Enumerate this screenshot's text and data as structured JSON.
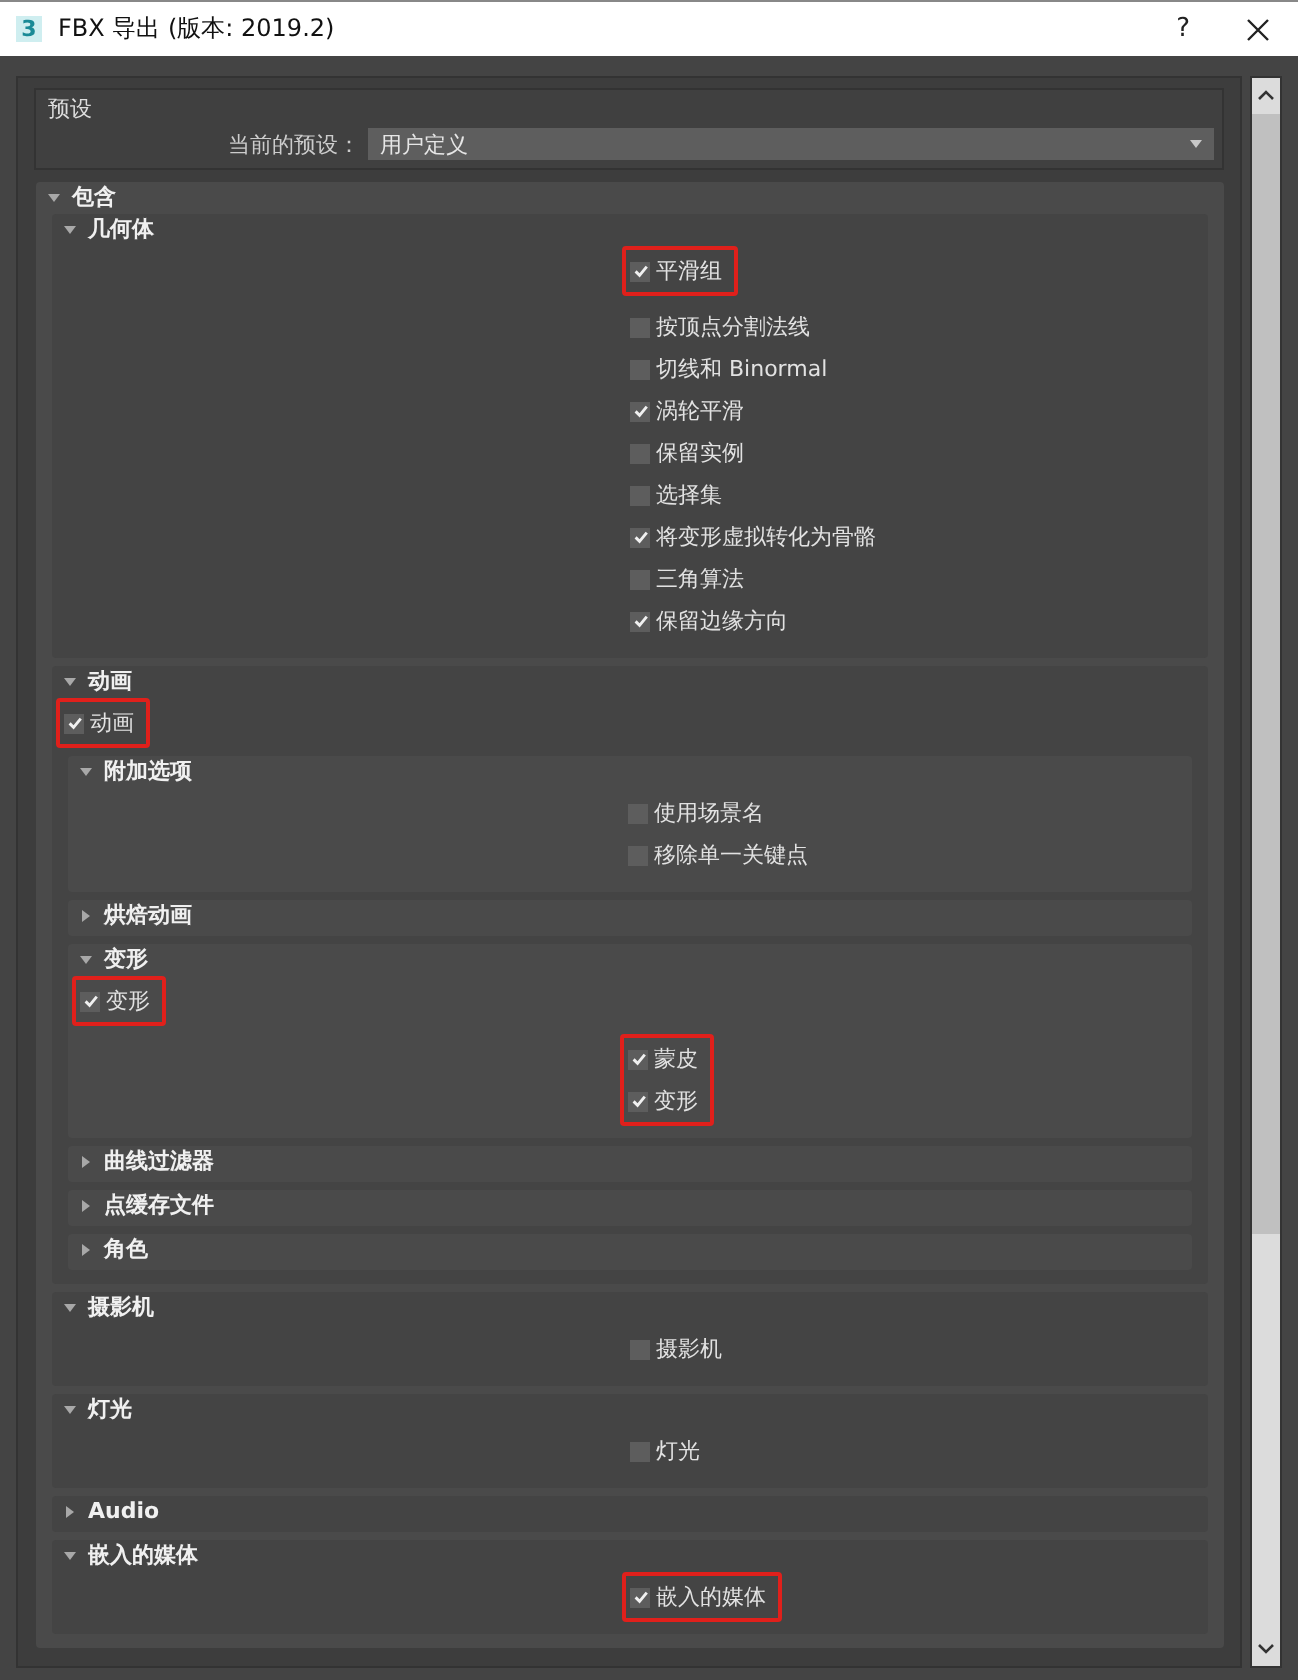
{
  "window": {
    "icon_label": "3",
    "title": "FBX 导出 (版本: 2019.2)",
    "help": "?"
  },
  "presets": {
    "title": "预设",
    "label": "当前的预设：",
    "value": "用户定义"
  },
  "rollouts": [
    {
      "kind": "rollout",
      "title": "包含",
      "expanded": true,
      "items": [
        {
          "kind": "rollout",
          "title": "几何体",
          "expanded": true,
          "items": [
            {
              "kind": "options",
              "highlighted": true,
              "options": [
                {
                  "label": "平滑组",
                  "checked": true
                }
              ]
            },
            {
              "kind": "options",
              "highlighted": false,
              "options": [
                {
                  "label": "按顶点分割法线",
                  "checked": false
                },
                {
                  "label": "切线和 Binormal",
                  "checked": false
                },
                {
                  "label": "涡轮平滑",
                  "checked": true
                },
                {
                  "label": "保留实例",
                  "checked": false
                },
                {
                  "label": "选择集",
                  "checked": false
                },
                {
                  "label": "将变形虚拟转化为骨骼",
                  "checked": true
                },
                {
                  "label": "三角算法",
                  "checked": false
                },
                {
                  "label": "保留边缘方向",
                  "checked": true
                }
              ]
            }
          ]
        },
        {
          "kind": "rollout",
          "title": "动画",
          "expanded": true,
          "items": [
            {
              "kind": "checkbox",
              "label": "动画",
              "checked": true,
              "highlighted": true
            },
            {
              "kind": "rollout",
              "title": "附加选项",
              "expanded": true,
              "items": [
                {
                  "kind": "options",
                  "highlighted": false,
                  "options": [
                    {
                      "label": "使用场景名",
                      "checked": false
                    },
                    {
                      "label": "移除单一关键点",
                      "checked": false
                    }
                  ]
                }
              ]
            },
            {
              "kind": "rollout",
              "title": "烘焙动画",
              "expanded": false
            },
            {
              "kind": "rollout",
              "title": "变形",
              "expanded": true,
              "items": [
                {
                  "kind": "checkbox",
                  "label": "变形",
                  "checked": true,
                  "highlighted": true
                },
                {
                  "kind": "options",
                  "highlighted": true,
                  "options": [
                    {
                      "label": "蒙皮",
                      "checked": true
                    },
                    {
                      "label": "变形",
                      "checked": true
                    }
                  ]
                }
              ]
            },
            {
              "kind": "rollout",
              "title": "曲线过滤器",
              "expanded": false
            },
            {
              "kind": "rollout",
              "title": "点缓存文件",
              "expanded": false
            },
            {
              "kind": "rollout",
              "title": "角色",
              "expanded": false
            }
          ]
        },
        {
          "kind": "rollout",
          "title": "摄影机",
          "expanded": true,
          "items": [
            {
              "kind": "options",
              "highlighted": false,
              "options": [
                {
                  "label": "摄影机",
                  "checked": false
                }
              ]
            }
          ]
        },
        {
          "kind": "rollout",
          "title": "灯光",
          "expanded": true,
          "items": [
            {
              "kind": "options",
              "highlighted": false,
              "options": [
                {
                  "label": "灯光",
                  "checked": false
                }
              ]
            }
          ]
        },
        {
          "kind": "rollout",
          "title": "Audio",
          "expanded": false
        },
        {
          "kind": "rollout",
          "title": "嵌入的媒体",
          "expanded": true,
          "items": [
            {
              "kind": "options",
              "highlighted": true,
              "options": [
                {
                  "label": "嵌入的媒体",
                  "checked": true
                }
              ]
            }
          ]
        }
      ]
    }
  ]
}
